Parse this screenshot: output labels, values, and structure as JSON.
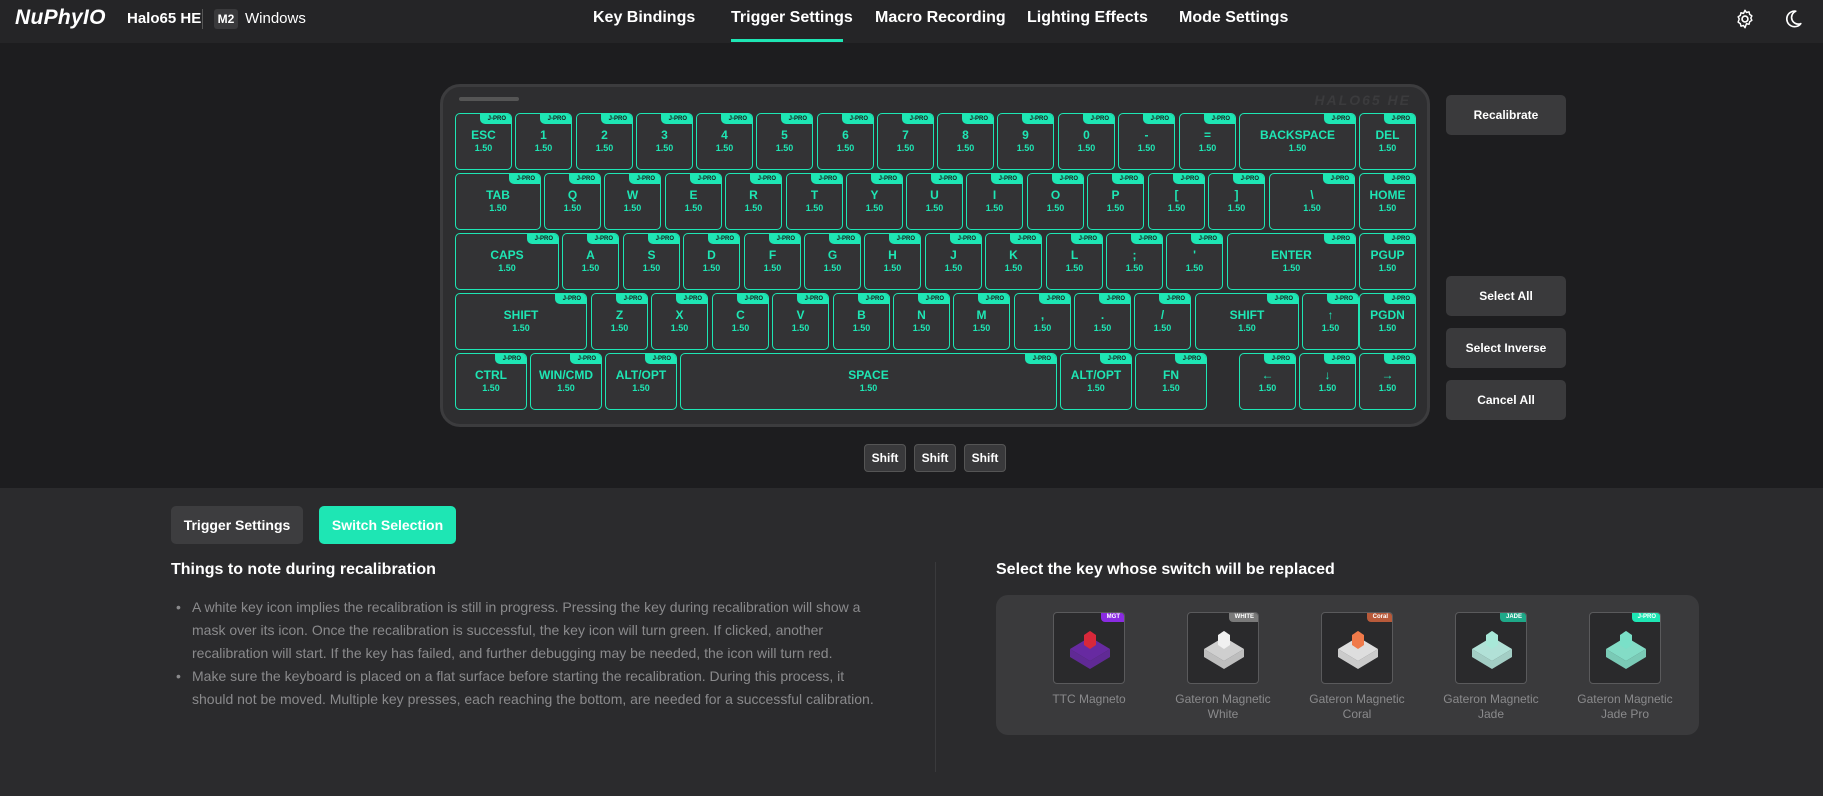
{
  "header": {
    "logo": "NuPhyIO",
    "model": "Halo65 HE",
    "mode_badge": "M2",
    "os": "Windows",
    "tabs": [
      "Key Bindings",
      "Trigger Settings",
      "Macro Recording",
      "Lighting Effects",
      "Mode Settings"
    ],
    "active_tab": "Trigger Settings",
    "icons": [
      "gear-icon",
      "moon-icon"
    ]
  },
  "keyboard": {
    "brand": "HALO65 HE",
    "switch_tag": "J-PRO",
    "rows": [
      [
        [
          "ESC",
          "1.50"
        ],
        [
          "1",
          "1.50"
        ],
        [
          "2",
          "1.50"
        ],
        [
          "3",
          "1.50"
        ],
        [
          "4",
          "1.50"
        ],
        [
          "5",
          "1.50"
        ],
        [
          "6",
          "1.50"
        ],
        [
          "7",
          "1.50"
        ],
        [
          "8",
          "1.50"
        ],
        [
          "9",
          "1.50"
        ],
        [
          "0",
          "1.50"
        ],
        [
          "-",
          "1.50"
        ],
        [
          "=",
          "1.50"
        ],
        [
          "BACKSPACE",
          "1.50"
        ],
        [
          "DEL",
          "1.50"
        ]
      ],
      [
        [
          "TAB",
          "1.50"
        ],
        [
          "Q",
          "1.50"
        ],
        [
          "W",
          "1.50"
        ],
        [
          "E",
          "1.50"
        ],
        [
          "R",
          "1.50"
        ],
        [
          "T",
          "1.50"
        ],
        [
          "Y",
          "1.50"
        ],
        [
          "U",
          "1.50"
        ],
        [
          "I",
          "1.50"
        ],
        [
          "O",
          "1.50"
        ],
        [
          "P",
          "1.50"
        ],
        [
          "[",
          "1.50"
        ],
        [
          "]",
          "1.50"
        ],
        [
          "\\",
          "1.50"
        ],
        [
          "HOME",
          "1.50"
        ]
      ],
      [
        [
          "CAPS",
          "1.50"
        ],
        [
          "A",
          "1.50"
        ],
        [
          "S",
          "1.50"
        ],
        [
          "D",
          "1.50"
        ],
        [
          "F",
          "1.50"
        ],
        [
          "G",
          "1.50"
        ],
        [
          "H",
          "1.50"
        ],
        [
          "J",
          "1.50"
        ],
        [
          "K",
          "1.50"
        ],
        [
          "L",
          "1.50"
        ],
        [
          ";",
          "1.50"
        ],
        [
          "'",
          "1.50"
        ],
        [
          "ENTER",
          "1.50"
        ],
        [
          "PGUP",
          "1.50"
        ]
      ],
      [
        [
          "SHIFT",
          "1.50"
        ],
        [
          "Z",
          "1.50"
        ],
        [
          "X",
          "1.50"
        ],
        [
          "C",
          "1.50"
        ],
        [
          "V",
          "1.50"
        ],
        [
          "B",
          "1.50"
        ],
        [
          "N",
          "1.50"
        ],
        [
          "M",
          "1.50"
        ],
        [
          ",",
          "1.50"
        ],
        [
          ".",
          "1.50"
        ],
        [
          "/",
          "1.50"
        ],
        [
          "SHIFT",
          "1.50"
        ],
        [
          "↑",
          "1.50"
        ],
        [
          "PGDN",
          "1.50"
        ]
      ],
      [
        [
          "CTRL",
          "1.50"
        ],
        [
          "WIN/CMD",
          "1.50"
        ],
        [
          "ALT/OPT",
          "1.50"
        ],
        [
          "SPACE",
          "1.50"
        ],
        [
          "ALT/OPT",
          "1.50"
        ],
        [
          "FN",
          "1.50"
        ],
        [
          "←",
          "1.50"
        ],
        [
          "↓",
          "1.50"
        ],
        [
          "→",
          "1.50"
        ]
      ]
    ]
  },
  "side_buttons": {
    "recalibrate": "Recalibrate",
    "select_all": "Select All",
    "select_inverse": "Select Inverse",
    "cancel_all": "Cancel All"
  },
  "shift_buttons": [
    "Shift",
    "Shift",
    "Shift"
  ],
  "bottom": {
    "tabs": {
      "trigger_settings": "Trigger Settings",
      "switch_selection": "Switch Selection"
    },
    "notes_title": "Things to note during recalibration",
    "notes": [
      "A white key icon implies the recalibration is still in progress. Pressing the key during recalibration will show a mask over its icon. Once the recalibration is successful, the key icon will turn green. If clicked, another recalibration will start. If the key has failed, and further debugging may be needed, the icon will turn red.",
      "Make sure the keyboard is placed on a flat surface before starting the recalibration. During this process, it should not be moved. Multiple key presses, each reaching the bottom, are needed for a successful calibration."
    ],
    "switch_title": "Select the key whose switch will be replaced",
    "switches": [
      {
        "tag": "MGT",
        "name": "TTC Magneto",
        "stem_color": "#d8283a",
        "housing_color": "#6a2aa8",
        "tag_color": "#8a2be2"
      },
      {
        "tag": "WHITE",
        "name": "Gateron Magnetic White",
        "stem_color": "#f0f0f0",
        "housing_color": "#d8d8d8",
        "tag_color": "#7a7a7a"
      },
      {
        "tag": "Coral",
        "name": "Gateron Magnetic Coral",
        "stem_color": "#f07a4a",
        "housing_color": "#e8e8e8",
        "tag_color": "#b85a3a"
      },
      {
        "tag": "JADE",
        "name": "Gateron Magnetic Jade",
        "stem_color": "#a8e8d8",
        "housing_color": "#b8ebe0",
        "tag_color": "#1ea888"
      },
      {
        "tag": "J-PRO",
        "name": "Gateron Magnetic Jade Pro",
        "stem_color": "#7ae0c8",
        "housing_color": "#88e6cf",
        "tag_color": "#1ee6b4"
      }
    ]
  },
  "colors": {
    "accent": "#1ee6b4",
    "bg": "#1d1d1f",
    "panel": "#2b2b2d"
  }
}
